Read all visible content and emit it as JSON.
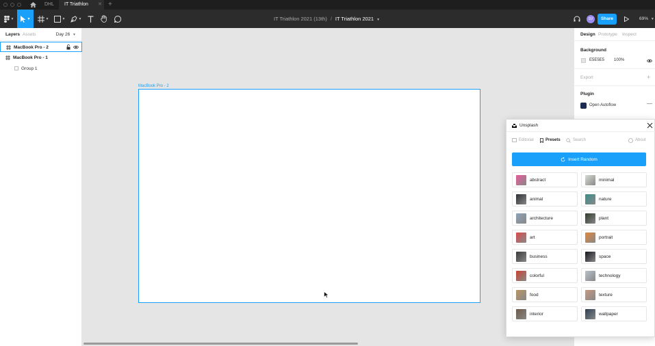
{
  "tabs": [
    {
      "label": "DHL"
    },
    {
      "label": "IT Triathlon 2021"
    }
  ],
  "toolbar": {
    "file_project": "IT Triathlon 2021 (13th)",
    "file_separator": "/",
    "file_name": "IT Triathlon 2021",
    "avatar_initials": "SV",
    "share_label": "Share",
    "zoom": "69%"
  },
  "left_panel": {
    "tab_layers": "Layers",
    "tab_assets": "Assets",
    "page": "Day 26",
    "layers": [
      {
        "label": "MacBook Pro - 2"
      },
      {
        "label": "MacBook Pro - 1"
      },
      {
        "label": "Group 1"
      }
    ]
  },
  "canvas": {
    "frame_label": "MacBook Pro - 2",
    "scroll_fraction": 0.56
  },
  "right_panel": {
    "tab_design": "Design",
    "tab_prototype": "Prototype",
    "tab_inspect": "Inspect",
    "background_title": "Background",
    "background_hex": "E5E5E5",
    "background_opacity": "100%",
    "export_title": "Export",
    "plugin_title": "Plugin",
    "plugin_name": "Open Autoflow"
  },
  "unsplash": {
    "title": "Unsplash",
    "tab_editorial": "Editorial",
    "tab_presets": "Presets",
    "tab_search": "Search",
    "tab_about": "About",
    "insert_label": "Insert Random",
    "presets": [
      {
        "label": "abstract",
        "color": "#e85d9a"
      },
      {
        "label": "minimal",
        "color": "#d7dcd3"
      },
      {
        "label": "animal",
        "color": "#2e2f33"
      },
      {
        "label": "nature",
        "color": "#3a8f8a"
      },
      {
        "label": "architecture",
        "color": "#8ea3b8"
      },
      {
        "label": "plant",
        "color": "#2f3a2a"
      },
      {
        "label": "art",
        "color": "#d94b4b"
      },
      {
        "label": "portrait",
        "color": "#e0873d"
      },
      {
        "label": "business",
        "color": "#3a3a3a"
      },
      {
        "label": "space",
        "color": "#15171c"
      },
      {
        "label": "colorful",
        "color": "#c9432f"
      },
      {
        "label": "technology",
        "color": "#b8c2cc"
      },
      {
        "label": "food",
        "color": "#b99664"
      },
      {
        "label": "texture",
        "color": "#c89a83"
      },
      {
        "label": "interior",
        "color": "#6e5a48"
      },
      {
        "label": "wallpaper",
        "color": "#2d3f52"
      }
    ]
  },
  "colors": {
    "accent": "#18A0FB",
    "toolbar": "#2C2C2C",
    "canvas": "#E5E5E5"
  }
}
